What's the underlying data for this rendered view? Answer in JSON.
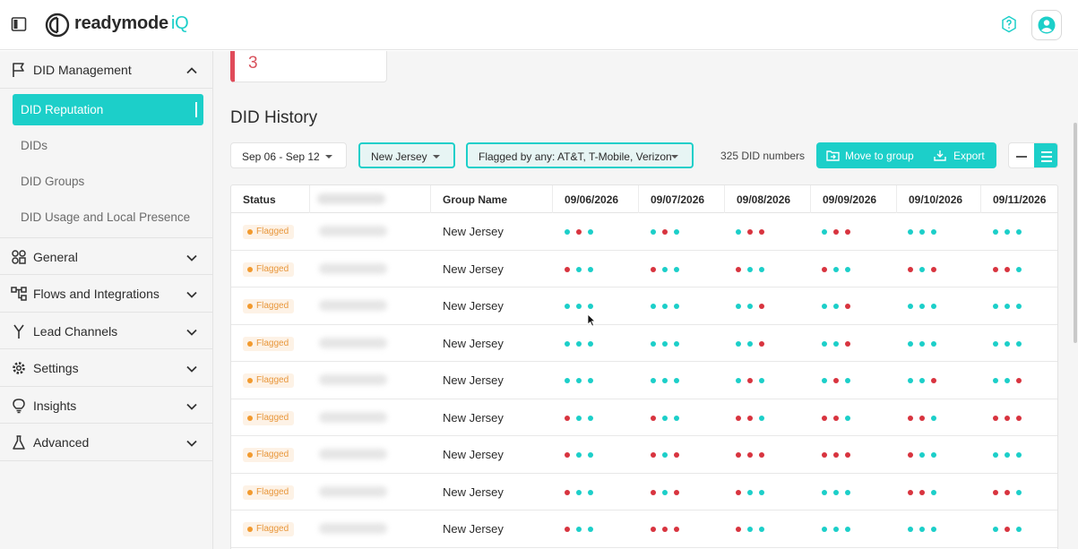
{
  "app": {
    "name": "readymode",
    "name_accent": "iQ"
  },
  "icons": {
    "sidebar_toggle": "sidebar-toggle-icon",
    "help": "question-circle-icon",
    "account": "user-circle-icon"
  },
  "colors": {
    "accent": "#1ccfc9",
    "flag_red": "#d8343f",
    "badge_orange": "#f29a2e"
  },
  "sidebar": {
    "sections": [
      {
        "label": "DID Management",
        "icon": "flag-icon",
        "expanded": true,
        "items": [
          {
            "label": "DID Reputation",
            "active": true
          },
          {
            "label": "DIDs",
            "active": false
          },
          {
            "label": "DID Groups",
            "active": false
          },
          {
            "label": "DID Usage and Local Presence",
            "active": false
          }
        ]
      },
      {
        "label": "General",
        "icon": "grid-icon",
        "expanded": false
      },
      {
        "label": "Flows and Integrations",
        "icon": "flow-icon",
        "expanded": false
      },
      {
        "label": "Lead Channels",
        "icon": "branch-icon",
        "expanded": false
      },
      {
        "label": "Settings",
        "icon": "gear-icon",
        "expanded": false
      },
      {
        "label": "Insights",
        "icon": "lightbulb-icon",
        "expanded": false
      },
      {
        "label": "Advanced",
        "icon": "flask-icon",
        "expanded": false
      }
    ]
  },
  "summary_card": {
    "value": "3"
  },
  "did_history": {
    "title": "DID History",
    "date_range": "Sep 06 - Sep 12",
    "group_filter": "New Jersey",
    "flag_filter": "Flagged by any: AT&T, T-Mobile, Verizon",
    "did_count": "325 DID numbers",
    "move_to_group_label": "Move to group",
    "export_label": "Export",
    "columns": {
      "status": "Status",
      "group": "Group Name",
      "dates": [
        "09/06/2026",
        "09/07/2026",
        "09/08/2026",
        "09/09/2026",
        "09/10/2026",
        "09/11/2026"
      ]
    },
    "rows": [
      {
        "status": "Flagged",
        "group": "New Jersey",
        "flags": [
          "grg",
          "grg",
          "grr",
          "grr",
          "ggg",
          "ggg"
        ]
      },
      {
        "status": "Flagged",
        "group": "New Jersey",
        "flags": [
          "rgg",
          "rgg",
          "rgg",
          "rgg",
          "rgr",
          "rrg"
        ]
      },
      {
        "status": "Flagged",
        "group": "New Jersey",
        "flags": [
          "ggg",
          "ggg",
          "ggr",
          "ggr",
          "ggg",
          "ggg"
        ]
      },
      {
        "status": "Flagged",
        "group": "New Jersey",
        "flags": [
          "ggg",
          "ggg",
          "ggr",
          "ggr",
          "ggg",
          "ggg"
        ]
      },
      {
        "status": "Flagged",
        "group": "New Jersey",
        "flags": [
          "ggg",
          "ggg",
          "grg",
          "grg",
          "ggr",
          "ggr"
        ]
      },
      {
        "status": "Flagged",
        "group": "New Jersey",
        "flags": [
          "rgg",
          "rgg",
          "rrg",
          "rrg",
          "rrg",
          "rrr"
        ]
      },
      {
        "status": "Flagged",
        "group": "New Jersey",
        "flags": [
          "rgg",
          "rgr",
          "rrr",
          "rrr",
          "rgg",
          "ggg"
        ]
      },
      {
        "status": "Flagged",
        "group": "New Jersey",
        "flags": [
          "rgg",
          "rgr",
          "rgg",
          "ggg",
          "rrg",
          "rrg"
        ]
      },
      {
        "status": "Flagged",
        "group": "New Jersey",
        "flags": [
          "rgg",
          "rrr",
          "rgg",
          "ggg",
          "ggg",
          "grg"
        ]
      }
    ]
  }
}
